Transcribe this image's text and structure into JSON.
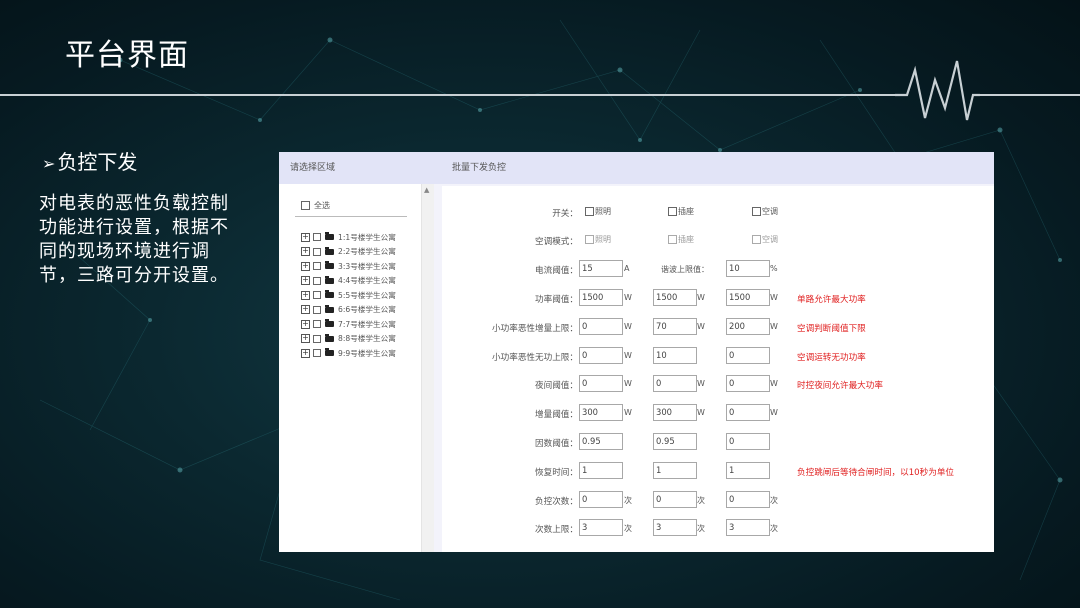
{
  "slide": {
    "title": "平台界面",
    "bullet": "负控下发",
    "description": "对电表的恶性负载控制功能进行设置，根据不同的现场环境进行调节，三路可分开设置。"
  },
  "left_panel": {
    "header": "请选择区域",
    "select_all": "全选",
    "tree": [
      "1:1号楼学生公寓",
      "2:2号楼学生公寓",
      "3:3号楼学生公寓",
      "4:4号楼学生公寓",
      "5:5号楼学生公寓",
      "6:6号楼学生公寓",
      "7:7号楼学生公寓",
      "8:8号楼学生公寓",
      "9:9号楼学生公寓"
    ]
  },
  "right_panel": {
    "header": "批量下发负控",
    "switch_row": {
      "label": "开关：",
      "options": [
        "照明",
        "插座",
        "空调"
      ]
    },
    "ac_mode_row": {
      "label": "空调模式：",
      "options": [
        "照明",
        "插座",
        "空调"
      ]
    },
    "current_row": {
      "label": "电流阈值：",
      "value": "15",
      "unit": "A",
      "harmonic_label": "谐波上限值：",
      "harmonic_value": "10",
      "harmonic_unit": "%"
    },
    "rows": [
      {
        "label": "功率阈值：",
        "values": [
          "1500",
          "1500",
          "1500"
        ],
        "units": [
          "W",
          "W",
          "W"
        ],
        "note": "单路允许最大功率"
      },
      {
        "label": "小功率恶性增量上限：",
        "values": [
          "0",
          "70",
          "200"
        ],
        "units": [
          "W",
          "W",
          "W"
        ],
        "note": "空调判断阈值下限"
      },
      {
        "label": "小功率恶性无功上限：",
        "values": [
          "0",
          "10",
          "0"
        ],
        "units": [
          "W",
          "",
          ""
        ],
        "note": "空调运转无功功率"
      },
      {
        "label": "夜间阈值：",
        "values": [
          "0",
          "0",
          "0"
        ],
        "units": [
          "W",
          "W",
          "W"
        ],
        "note": "时控夜间允许最大功率"
      },
      {
        "label": "增量阈值：",
        "values": [
          "300",
          "300",
          "0"
        ],
        "units": [
          "W",
          "W",
          "W"
        ],
        "note": ""
      },
      {
        "label": "因数阈值：",
        "values": [
          "0.95",
          "0.95",
          "0"
        ],
        "units": [
          "",
          "",
          ""
        ],
        "note": ""
      },
      {
        "label": "恢复时间：",
        "values": [
          "1",
          "1",
          "1"
        ],
        "units": [
          "",
          "",
          ""
        ],
        "note": "负控跳闸后等待合闸时间，以10秒为单位"
      },
      {
        "label": "负控次数：",
        "values": [
          "0",
          "0",
          "0"
        ],
        "units": [
          "次",
          "次",
          "次"
        ],
        "note": ""
      },
      {
        "label": "次数上限：",
        "values": [
          "3",
          "3",
          "3"
        ],
        "units": [
          "次",
          "次",
          "次"
        ],
        "note": ""
      }
    ]
  }
}
